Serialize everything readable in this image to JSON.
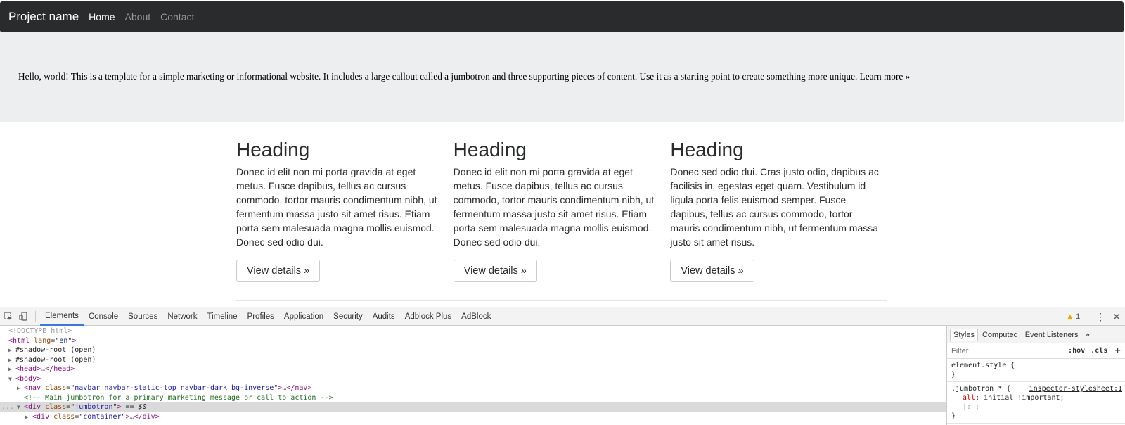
{
  "navbar": {
    "brand": "Project name",
    "links": [
      {
        "label": "Home",
        "active": true
      },
      {
        "label": "About",
        "active": false
      },
      {
        "label": "Contact",
        "active": false
      }
    ]
  },
  "jumbotron": {
    "text": "Hello, world! This is a template for a simple marketing or informational website. It includes a large callout called a jumbotron and three supporting pieces of content. Use it as a starting point to create something more unique. Learn more »"
  },
  "columns": [
    {
      "heading": "Heading",
      "text": "Donec id elit non mi porta gravida at eget metus. Fusce dapibus, tellus ac cursus commodo, tortor mauris condimentum nibh, ut fermentum massa justo sit amet risus. Etiam porta sem malesuada magna mollis euismod. Donec sed odio dui.",
      "button": "View details »"
    },
    {
      "heading": "Heading",
      "text": "Donec id elit non mi porta gravida at eget metus. Fusce dapibus, tellus ac cursus commodo, tortor mauris condimentum nibh, ut fermentum massa justo sit amet risus. Etiam porta sem malesuada magna mollis euismod. Donec sed odio dui.",
      "button": "View details »"
    },
    {
      "heading": "Heading",
      "text": "Donec sed odio dui. Cras justo odio, dapibus ac facilisis in, egestas eget quam. Vestibulum id ligula porta felis euismod semper. Fusce dapibus, tellus ac cursus commodo, tortor mauris condimentum nibh, ut fermentum massa justo sit amet risus.",
      "button": "View details »"
    }
  ],
  "devtools": {
    "tabs": [
      "Elements",
      "Console",
      "Sources",
      "Network",
      "Timeline",
      "Profiles",
      "Application",
      "Security",
      "Audits",
      "Adblock Plus",
      "AdBlock"
    ],
    "active_tab": "Elements",
    "warning_count": "1",
    "icons": {
      "inspect": "inspect-icon",
      "device": "device-toolbar-icon",
      "warning": "warning-icon",
      "menu": "more-menu-icon",
      "close": "close-icon"
    },
    "dom": {
      "doctype": "<!DOCTYPE html>",
      "html_tag": "html",
      "html_attr": "lang",
      "html_val": "en",
      "shadow1": "#shadow-root (open)",
      "shadow2": "#shadow-root (open)",
      "head_open": "<head>",
      "head_close": "</head>",
      "ellipsis": "…",
      "body": "<body>",
      "nav_tag": "nav",
      "nav_attr": "class",
      "nav_val": "navbar navbar-static-top navbar-dark bg-inverse",
      "nav_close": "</nav>",
      "comment": "<!-- Main jumbotron for a primary marketing message or call to action -->",
      "jumbo_tag": "div",
      "jumbo_attr": "class",
      "jumbo_val": "jumbotron",
      "jumbo_suffix": " == $0",
      "container_tag": "div",
      "container_attr": "class",
      "container_val": "container",
      "container_close": "</div>",
      "gutter": "..."
    },
    "styles": {
      "tabs": [
        "Styles",
        "Computed",
        "Event Listeners"
      ],
      "active_tab": "Styles",
      "more": "»",
      "filter_placeholder": "Filter",
      "hov": ":hov",
      "cls": ".cls",
      "plus": "+",
      "rule1_selector": "element.style {",
      "rule1_close": "}",
      "rule2_selector": ".jumbotron * {",
      "rule2_source": "inspector-stylesheet:1",
      "rule2_prop": "all",
      "rule2_val": "initial !important;",
      "rule2_extra": "|: ;",
      "rule2_close": "}"
    }
  }
}
